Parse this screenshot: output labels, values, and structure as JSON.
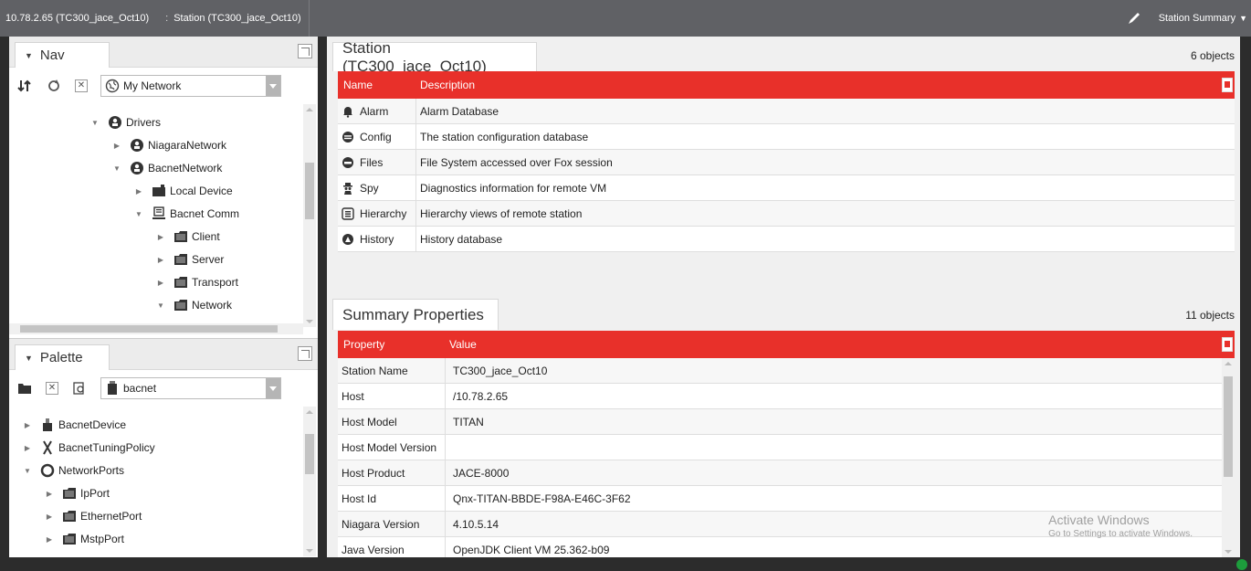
{
  "topbar": {
    "host": "10.78.2.65 (TC300_jace_Oct10)",
    "station_crumb": "Station (TC300_jace_Oct10)",
    "separator": ":",
    "view_selector": "Station Summary"
  },
  "nav": {
    "title": "Nav",
    "network_select": "My Network",
    "tree": [
      {
        "label": "Drivers",
        "indent": 1,
        "expanded": true
      },
      {
        "label": "NiagaraNetwork",
        "indent": 2,
        "expanded": false
      },
      {
        "label": "BacnetNetwork",
        "indent": 2,
        "expanded": true
      },
      {
        "label": "Local Device",
        "indent": 3,
        "expanded": false
      },
      {
        "label": "Bacnet Comm",
        "indent": 3,
        "expanded": true
      },
      {
        "label": "Client",
        "indent": 4,
        "expanded": false
      },
      {
        "label": "Server",
        "indent": 4,
        "expanded": false
      },
      {
        "label": "Transport",
        "indent": 4,
        "expanded": false
      },
      {
        "label": "Network",
        "indent": 4,
        "expanded": true
      }
    ]
  },
  "palette": {
    "title": "Palette",
    "module_select": "bacnet",
    "tree": [
      {
        "label": "BacnetDevice",
        "indent": 0,
        "expanded": false
      },
      {
        "label": "BacnetTuningPolicy",
        "indent": 0,
        "expanded": false
      },
      {
        "label": "NetworkPorts",
        "indent": 0,
        "expanded": true
      },
      {
        "label": "IpPort",
        "indent": 1,
        "expanded": false
      },
      {
        "label": "EthernetPort",
        "indent": 1,
        "expanded": false
      },
      {
        "label": "MstpPort",
        "indent": 1,
        "expanded": false
      }
    ]
  },
  "station": {
    "title": "Station (TC300_jace_Oct10)",
    "count": "6 objects",
    "columns": [
      "Name",
      "Description"
    ],
    "rows": [
      {
        "icon": "bell-icon",
        "name": "Alarm",
        "description": "Alarm Database"
      },
      {
        "icon": "database-icon",
        "name": "Config",
        "description": "The station configuration database"
      },
      {
        "icon": "drive-icon",
        "name": "Files",
        "description": "File System accessed over Fox session"
      },
      {
        "icon": "spy-icon",
        "name": "Spy",
        "description": "Diagnostics information for remote VM"
      },
      {
        "icon": "hierarchy-icon",
        "name": "Hierarchy",
        "description": "Hierarchy views of remote station"
      },
      {
        "icon": "history-icon",
        "name": "History",
        "description": "History database"
      }
    ]
  },
  "summary": {
    "title": "Summary Properties",
    "count": "11 objects",
    "columns": [
      "Property",
      "Value"
    ],
    "rows": [
      {
        "property": "Station Name",
        "value": "TC300_jace_Oct10"
      },
      {
        "property": "Host",
        "value": "/10.78.2.65"
      },
      {
        "property": "Host Model",
        "value": "TITAN"
      },
      {
        "property": "Host Model Version",
        "value": ""
      },
      {
        "property": "Host Product",
        "value": "JACE-8000"
      },
      {
        "property": "Host Id",
        "value": "Qnx-TITAN-BBDE-F98A-E46C-3F62"
      },
      {
        "property": "Niagara Version",
        "value": "4.10.5.14"
      },
      {
        "property": "Java Version",
        "value": "OpenJDK Client VM 25.362-b09"
      }
    ]
  },
  "watermark": {
    "line1": "Activate Windows",
    "line2": "Go to Settings to activate Windows."
  },
  "colors": {
    "header_red": "#e8302a",
    "topbar_gray": "#606165",
    "status_green": "#1d9c3c"
  }
}
